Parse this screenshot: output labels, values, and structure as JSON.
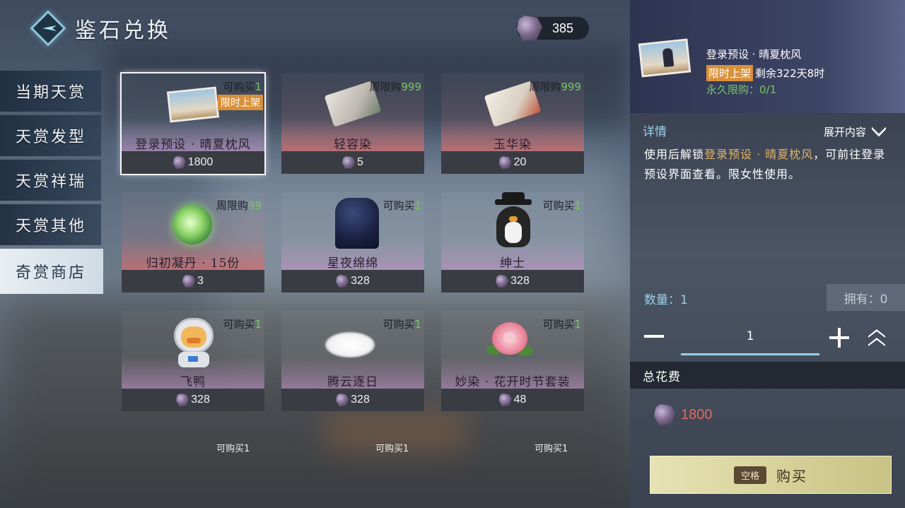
{
  "header": {
    "title": "鉴石兑换",
    "currency_amount": "385",
    "currency_icon": "stone-gem-icon"
  },
  "tabs": [
    {
      "label": "当期天赏",
      "active": false
    },
    {
      "label": "天赏发型",
      "active": false
    },
    {
      "label": "天赏祥瑞",
      "active": false
    },
    {
      "label": "天赏其他",
      "active": false
    },
    {
      "label": "奇赏商店",
      "active": true
    }
  ],
  "items": [
    {
      "name": "登录预设 · 晴夏枕风",
      "limit_prefix": "可购买",
      "limit_num": "1",
      "tag": "限时上架",
      "price": "1800",
      "icon": "postcard-icon",
      "selected": true
    },
    {
      "name": "轻容染",
      "limit_prefix": "周限购",
      "limit_num": "999",
      "price": "5",
      "icon": "fabric-dye-icon"
    },
    {
      "name": "玉华染",
      "limit_prefix": "周限购",
      "limit_num": "999",
      "price": "20",
      "icon": "fabric-dye-icon"
    },
    {
      "name": "归初凝丹 · 15份",
      "limit_prefix": "周限购",
      "limit_num": "99",
      "price": "3",
      "icon": "green-orb-icon"
    },
    {
      "name": "星夜绵绵",
      "limit_prefix": "可购买",
      "limit_num": "1",
      "price": "328",
      "icon": "starry-cloth-icon"
    },
    {
      "name": "绅士",
      "limit_prefix": "可购买",
      "limit_num": "1",
      "price": "328",
      "icon": "gentleman-penguin-icon"
    },
    {
      "name": "飞鸭",
      "limit_prefix": "可购买",
      "limit_num": "1",
      "price": "328",
      "icon": "astronaut-duck-icon"
    },
    {
      "name": "腾云逐日",
      "limit_prefix": "可购买",
      "limit_num": "1",
      "price": "328",
      "icon": "white-cloud-icon"
    },
    {
      "name": "妙染 · 花开时节套装",
      "limit_prefix": "可购买",
      "limit_num": "1",
      "price": "48",
      "icon": "peony-flower-icon"
    }
  ],
  "partial_row": [
    "可购买1",
    "可购买1",
    "可购买1"
  ],
  "detail": {
    "title": "登录预设 · 晴夏枕风",
    "badge": "限时上架",
    "remaining": "剩余322天8时",
    "perm_limit": "永久限购：0/1",
    "section_label": "详情",
    "expand_label": "展开内容",
    "desc_pre": "使用后解锁",
    "desc_hl": "登录预设 · 晴夏枕风",
    "desc_post": "，可前往登录预设界面查看。限女性使用。"
  },
  "quantity": {
    "label": "数量：1",
    "own": "拥有：0",
    "value": "1"
  },
  "total": {
    "label": "总花费",
    "value": "1800"
  },
  "buy": {
    "key": "空格",
    "label": "购买"
  },
  "colors": {
    "accent_gold": "#d9903a",
    "limit_green": "#7bc46a",
    "total_red": "#e06a64",
    "label_blue": "#9bd0ea"
  }
}
